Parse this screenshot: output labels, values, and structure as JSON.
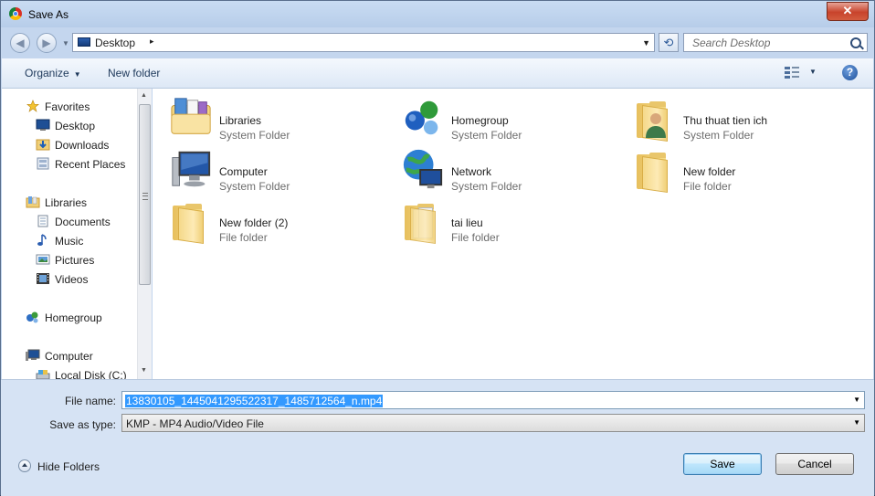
{
  "window": {
    "title": "Save As",
    "close_glyph": "✕"
  },
  "address": {
    "path": "Desktop",
    "arrow": "▸",
    "drop": "▼",
    "refresh_glyph": "⟲"
  },
  "search": {
    "placeholder": "Search Desktop"
  },
  "nav": {
    "back": "◀",
    "forward": "▶",
    "drop": "▼"
  },
  "toolbar": {
    "organize": "Organize",
    "caret": "▼",
    "new_folder": "New folder",
    "help": "?"
  },
  "navpane": {
    "favorites": "Favorites",
    "desktop": "Desktop",
    "downloads": "Downloads",
    "recent_places": "Recent Places",
    "libraries": "Libraries",
    "documents": "Documents",
    "music": "Music",
    "pictures": "Pictures",
    "videos": "Videos",
    "homegroup": "Homegroup",
    "computer": "Computer",
    "local_disk": "Local Disk (C:)",
    "scroll_up": "▲",
    "scroll_down": "▼"
  },
  "items": [
    {
      "name": "Libraries",
      "type": "System Folder",
      "icon": "libraries-icon"
    },
    {
      "name": "Homegroup",
      "type": "System Folder",
      "icon": "homegroup-icon"
    },
    {
      "name": "Thu thuat tien ich",
      "type": "System Folder",
      "icon": "user-folder-icon"
    },
    {
      "name": "Computer",
      "type": "System Folder",
      "icon": "computer-icon"
    },
    {
      "name": "Network",
      "type": "System Folder",
      "icon": "network-icon"
    },
    {
      "name": "New folder",
      "type": "File folder",
      "icon": "folder-icon"
    },
    {
      "name": "New folder (2)",
      "type": "File folder",
      "icon": "folder-icon"
    },
    {
      "name": "tai lieu",
      "type": "File folder",
      "icon": "folder-icon"
    }
  ],
  "form": {
    "file_name_label": "File name:",
    "file_name_value": "13830105_1445041295522317_1485712564_n.mp4",
    "save_type_label": "Save as type:",
    "save_type_value": "KMP - MP4 Audio/Video File",
    "drop": "▼"
  },
  "footer": {
    "hide_folders": "Hide Folders",
    "save": "Save",
    "cancel": "Cancel"
  }
}
